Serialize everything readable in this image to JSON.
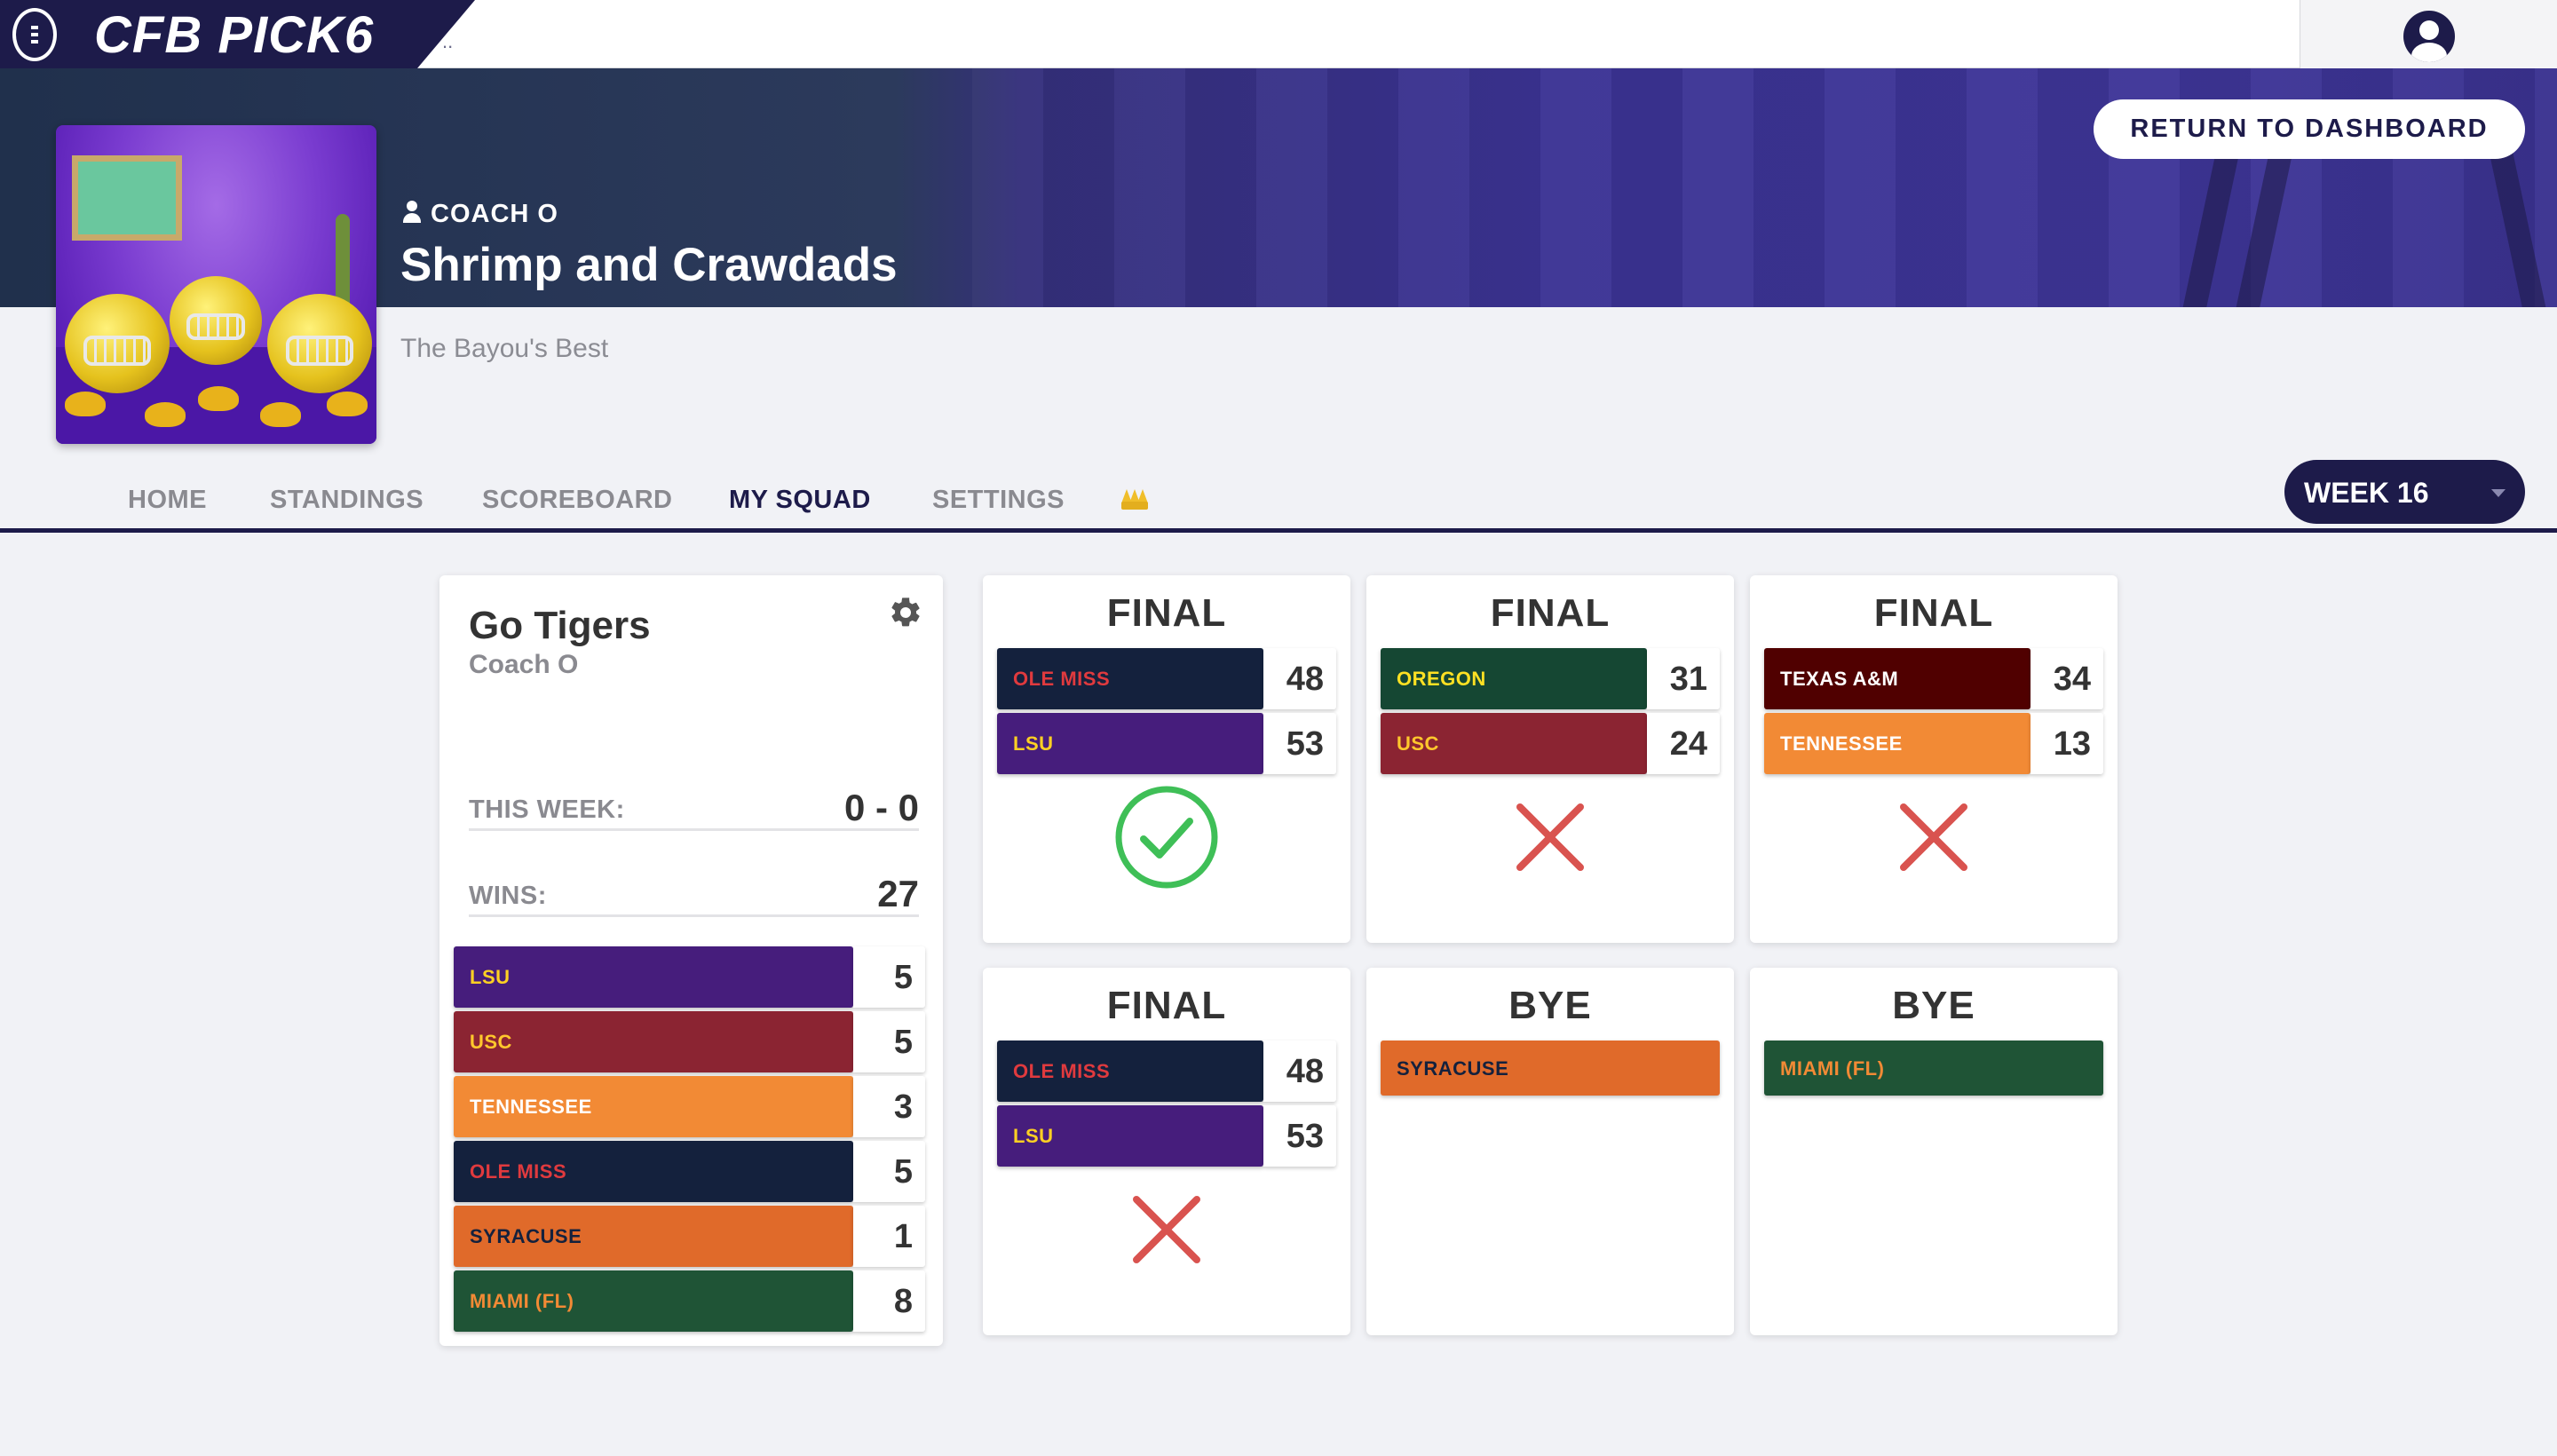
{
  "app": {
    "title": "CFB PICK6",
    "title_tail": ".."
  },
  "banner": {
    "return_button": "RETURN TO DASHBOARD",
    "coach": "COACH O",
    "team_name": "Shrimp and Crawdads",
    "tagline": "The Bayou's Best"
  },
  "nav": {
    "items": [
      "HOME",
      "STANDINGS",
      "SCOREBOARD",
      "MY SQUAD",
      "SETTINGS"
    ],
    "active": "MY SQUAD",
    "crown_icon": "crown-icon"
  },
  "week_select": {
    "value": "WEEK 16"
  },
  "squad": {
    "name": "Go Tigers",
    "coach": "Coach O",
    "this_week_label": "THIS WEEK:",
    "this_week_value": "0 - 0",
    "wins_label": "WINS:",
    "wins_value": "27",
    "teams": [
      {
        "name": "LSU",
        "count": "5"
      },
      {
        "name": "USC",
        "count": "5"
      },
      {
        "name": "TENNESSEE",
        "count": "3"
      },
      {
        "name": "OLE MISS",
        "count": "5"
      },
      {
        "name": "SYRACUSE",
        "count": "1"
      },
      {
        "name": "MIAMI (FL)",
        "count": "8"
      }
    ]
  },
  "games": [
    {
      "status": "FINAL",
      "teams": [
        {
          "name": "OLE MISS",
          "score": "48"
        },
        {
          "name": "LSU",
          "score": "53"
        }
      ],
      "result": "correct"
    },
    {
      "status": "FINAL",
      "teams": [
        {
          "name": "OREGON",
          "score": "31"
        },
        {
          "name": "USC",
          "score": "24"
        }
      ],
      "result": "wrong"
    },
    {
      "status": "FINAL",
      "teams": [
        {
          "name": "TEXAS A&M",
          "score": "34"
        },
        {
          "name": "TENNESSEE",
          "score": "13"
        }
      ],
      "result": "wrong"
    },
    {
      "status": "FINAL",
      "teams": [
        {
          "name": "OLE MISS",
          "score": "48"
        },
        {
          "name": "LSU",
          "score": "53"
        }
      ],
      "result": "wrong"
    },
    {
      "status": "BYE",
      "teams": [
        {
          "name": "SYRACUSE"
        }
      ]
    },
    {
      "status": "BYE",
      "teams": [
        {
          "name": "MIAMI (FL)"
        }
      ]
    }
  ],
  "colors": {
    "navy": "#1d1b4a",
    "correct_green": "#3fbf57",
    "wrong_red": "#d9534f"
  }
}
